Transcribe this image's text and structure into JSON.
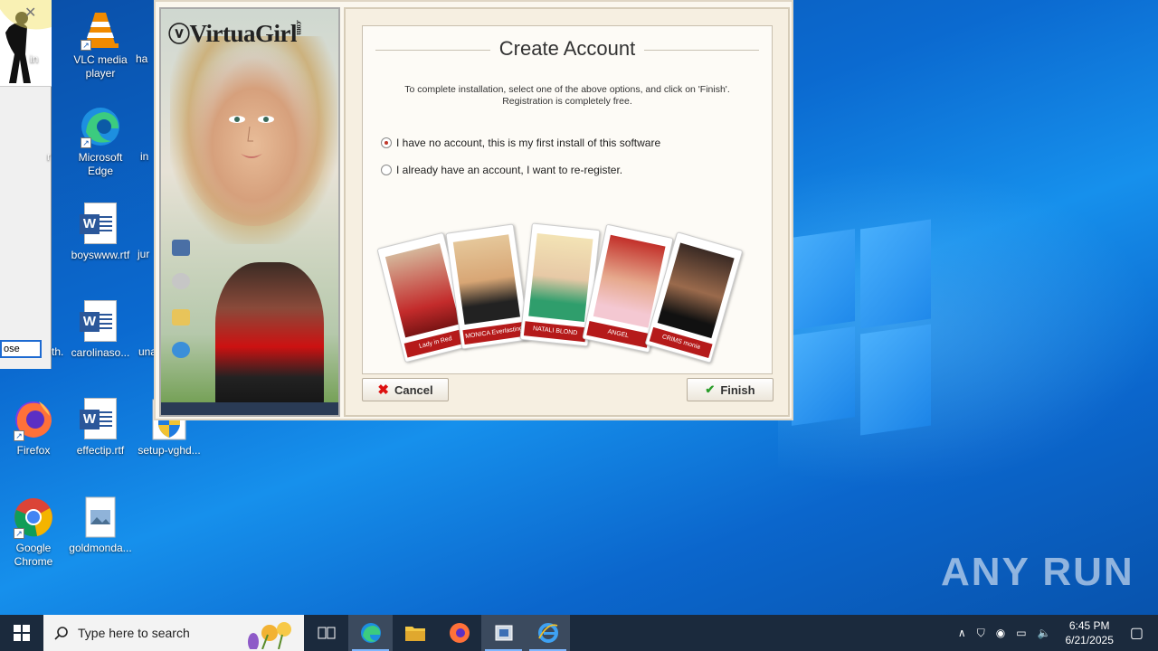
{
  "desktop": {
    "icons": [
      {
        "label": "in",
        "id": "partial-in"
      },
      {
        "label": "VLC media player",
        "id": "vlc"
      },
      {
        "label": "ha",
        "id": "partial-ha"
      },
      {
        "label": "r",
        "id": "partial-r"
      },
      {
        "label": "Microsoft Edge",
        "id": "edge"
      },
      {
        "label": "in",
        "id": "partial-in2"
      },
      {
        "label": "boyswww.rtf",
        "id": "boyswww"
      },
      {
        "label": "jur",
        "id": "partial-jur"
      },
      {
        "label": "th.",
        "id": "partial-th"
      },
      {
        "label": "carolinaso...",
        "id": "carolinaso"
      },
      {
        "label": "una",
        "id": "partial-una"
      },
      {
        "label": "Firefox",
        "id": "firefox"
      },
      {
        "label": "effectip.rtf",
        "id": "effectip"
      },
      {
        "label": "setup-vghd...",
        "id": "setup"
      },
      {
        "label": "Google Chrome",
        "id": "chrome"
      },
      {
        "label": "goldmonda...",
        "id": "goldmonda"
      }
    ],
    "left_window_close_label": "ose"
  },
  "installer": {
    "brand": "VirtuaGirl",
    "brand_suffix": ".com",
    "title": "Create Account",
    "description_line1": "To complete installation, select one of the above options, and click on 'Finish'.",
    "description_line2": "Registration is completely free.",
    "options": [
      {
        "label": "I have no account, this is my first install of this software",
        "selected": true
      },
      {
        "label": "I already have an account, I want to re-register.",
        "selected": false
      }
    ],
    "cards": [
      {
        "caption": "Lady in Red"
      },
      {
        "caption": "MONICA Everlasting L"
      },
      {
        "caption": "NATALI BLOND Texas Bar"
      },
      {
        "caption": "ANGEL"
      },
      {
        "caption": "CRIMS monia"
      }
    ],
    "cancel_label": "Cancel",
    "finish_label": "Finish"
  },
  "watermark": "ANY RUN",
  "taskbar": {
    "search_placeholder": "Type here to search",
    "time": "6:45 PM",
    "date": "6/21/2025"
  }
}
